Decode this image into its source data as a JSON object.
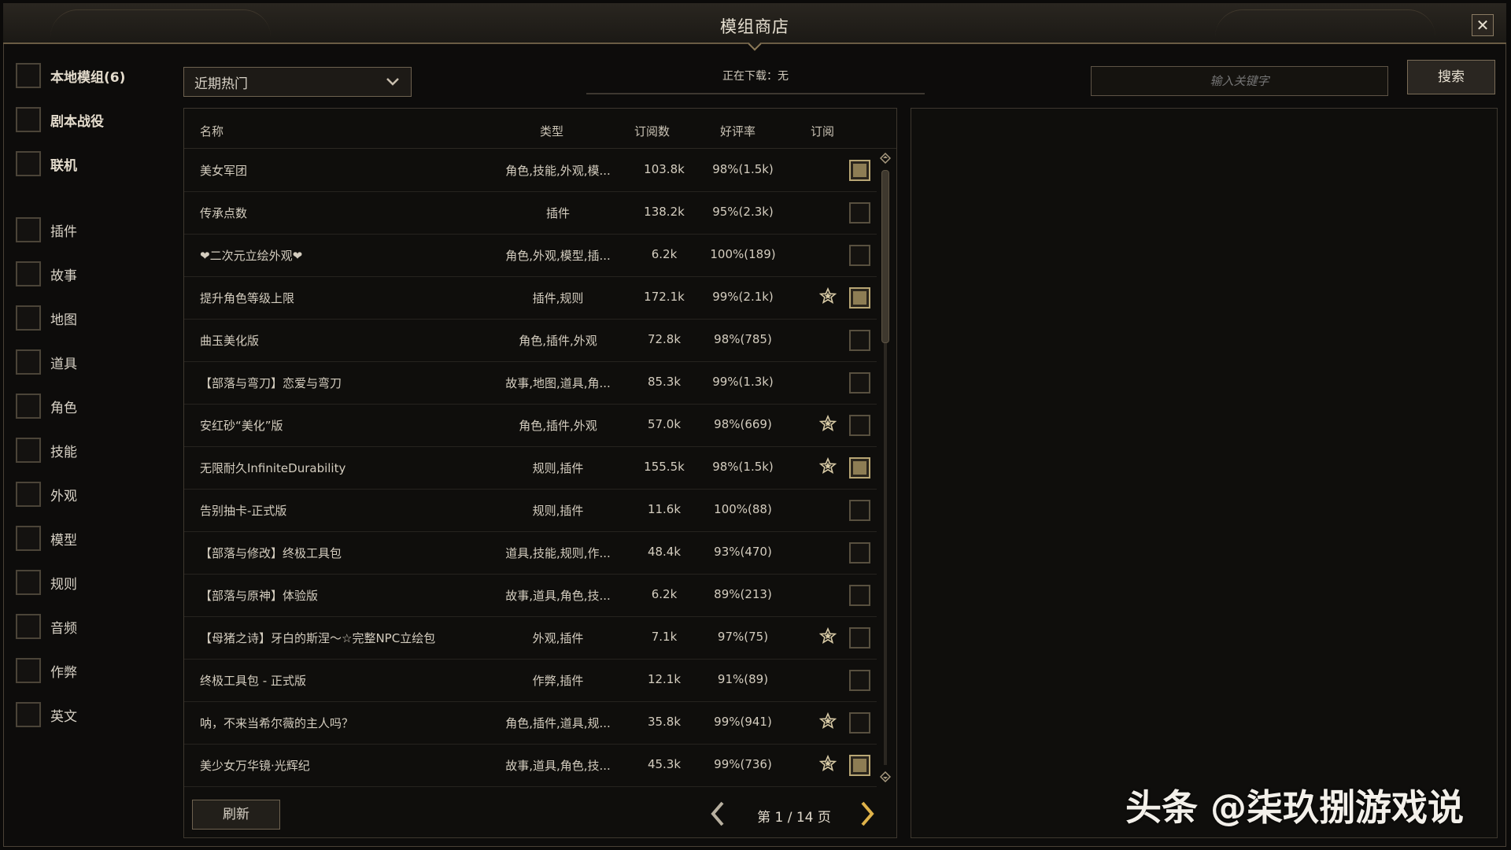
{
  "window": {
    "title": "模组商店",
    "close_label": "✕"
  },
  "sidebar": {
    "primary": [
      {
        "label": "本地模组(6)"
      },
      {
        "label": "剧本战役"
      },
      {
        "label": "联机"
      }
    ],
    "categories": [
      {
        "label": "插件"
      },
      {
        "label": "故事"
      },
      {
        "label": "地图"
      },
      {
        "label": "道具"
      },
      {
        "label": "角色"
      },
      {
        "label": "技能"
      },
      {
        "label": "外观"
      },
      {
        "label": "模型"
      },
      {
        "label": "规则"
      },
      {
        "label": "音频"
      },
      {
        "label": "作弊"
      },
      {
        "label": "英文"
      }
    ]
  },
  "toolbar": {
    "sort_selected": "近期热门",
    "download_status": "正在下载：无",
    "search_placeholder": "输入关键字",
    "search_label": "搜索"
  },
  "table": {
    "headers": {
      "name": "名称",
      "type": "类型",
      "subs": "订阅数",
      "rate": "好评率",
      "subscribe": "订阅"
    },
    "rows": [
      {
        "name": "美女军团",
        "type": "角色,技能,外观,模...",
        "subs": "103.8k",
        "rate": "98%(1.5k)",
        "starred": false,
        "subscribed": true
      },
      {
        "name": "传承点数",
        "type": "插件",
        "subs": "138.2k",
        "rate": "95%(2.3k)",
        "starred": false,
        "subscribed": false
      },
      {
        "name": "❤二次元立绘外观❤",
        "type": "角色,外观,模型,插...",
        "subs": "6.2k",
        "rate": "100%(189)",
        "starred": false,
        "subscribed": false
      },
      {
        "name": "提升角色等级上限",
        "type": "插件,规则",
        "subs": "172.1k",
        "rate": "99%(2.1k)",
        "starred": true,
        "subscribed": true
      },
      {
        "name": "曲玉美化版",
        "type": "角色,插件,外观",
        "subs": "72.8k",
        "rate": "98%(785)",
        "starred": false,
        "subscribed": false
      },
      {
        "name": "【部落与弯刀】恋爱与弯刀",
        "type": "故事,地图,道具,角...",
        "subs": "85.3k",
        "rate": "99%(1.3k)",
        "starred": false,
        "subscribed": false
      },
      {
        "name": "安红砂“美化”版",
        "type": "角色,插件,外观",
        "subs": "57.0k",
        "rate": "98%(669)",
        "starred": true,
        "subscribed": false
      },
      {
        "name": "无限耐久InfiniteDurability",
        "type": "规则,插件",
        "subs": "155.5k",
        "rate": "98%(1.5k)",
        "starred": true,
        "subscribed": true
      },
      {
        "name": "告别抽卡-正式版",
        "type": "规则,插件",
        "subs": "11.6k",
        "rate": "100%(88)",
        "starred": false,
        "subscribed": false
      },
      {
        "name": "【部落与修改】终极工具包",
        "type": "道具,技能,规则,作...",
        "subs": "48.4k",
        "rate": "93%(470)",
        "starred": false,
        "subscribed": false
      },
      {
        "name": "【部落与原神】体验版",
        "type": "故事,道具,角色,技...",
        "subs": "6.2k",
        "rate": "89%(213)",
        "starred": false,
        "subscribed": false
      },
      {
        "name": "【母猪之诗】牙白的斯涅～☆完整NPC立绘包",
        "type": "外观,插件",
        "subs": "7.1k",
        "rate": "97%(75)",
        "starred": true,
        "subscribed": false
      },
      {
        "name": "终极工具包 - 正式版",
        "type": "作弊,插件",
        "subs": "12.1k",
        "rate": "91%(89)",
        "starred": false,
        "subscribed": false
      },
      {
        "name": "呐，不来当希尔薇的主人吗？",
        "type": "角色,插件,道具,规...",
        "subs": "35.8k",
        "rate": "99%(941)",
        "starred": true,
        "subscribed": false
      },
      {
        "name": "美少女万华镜·光辉纪",
        "type": "故事,道具,角色,技...",
        "subs": "45.3k",
        "rate": "99%(736)",
        "starred": true,
        "subscribed": true
      }
    ]
  },
  "footer": {
    "refresh_label": "刷新",
    "page_text": "第 1 / 14 页"
  },
  "watermark": "头条 @柒玖捌游戏说",
  "colors": {
    "accent_gold": "#b8a674",
    "background": "#0d0c0b",
    "border": "#4a4237"
  }
}
